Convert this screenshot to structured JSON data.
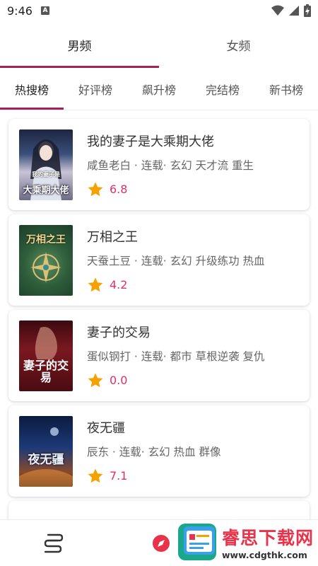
{
  "status_bar": {
    "time": "9:46",
    "notification_icon": "a-icon"
  },
  "gender_tabs": [
    {
      "label": "男频",
      "active": true
    },
    {
      "label": "女频",
      "active": false
    }
  ],
  "rank_tabs": [
    {
      "label": "热搜榜",
      "active": true
    },
    {
      "label": "好评榜",
      "active": false
    },
    {
      "label": "飙升榜",
      "active": false
    },
    {
      "label": "完结榜",
      "active": false
    },
    {
      "label": "新书榜",
      "active": false
    }
  ],
  "books": [
    {
      "title": "我的妻子是大乘期大佬",
      "meta": "咸鱼老白 · 连载· 玄幻 天才流 重生",
      "rating": "6.8",
      "cover_text": "大乘期大佬",
      "cover_top": "我的妻子是"
    },
    {
      "title": "万相之王",
      "meta": "天蚕土豆 · 连载· 玄幻 升级练功 热血",
      "rating": "4.2",
      "cover_text": "",
      "cover_top": "万相之王"
    },
    {
      "title": "妻子的交易",
      "meta": "蛋似钢打 · 连载· 都市 草根逆袭 复仇",
      "rating": "0.0",
      "cover_text": "妻子的交易",
      "cover_top": ""
    },
    {
      "title": "夜无疆",
      "meta": "辰东 · 连载· 玄幻 热血 群像",
      "rating": "7.1",
      "cover_text": "夜无疆",
      "cover_top": ""
    }
  ],
  "watermark": {
    "name": "睿思下载网",
    "url": "www.cdgthk.com"
  },
  "colors": {
    "accent": "#a8205a",
    "rating": "#e0306a",
    "star": "#f5a200"
  }
}
